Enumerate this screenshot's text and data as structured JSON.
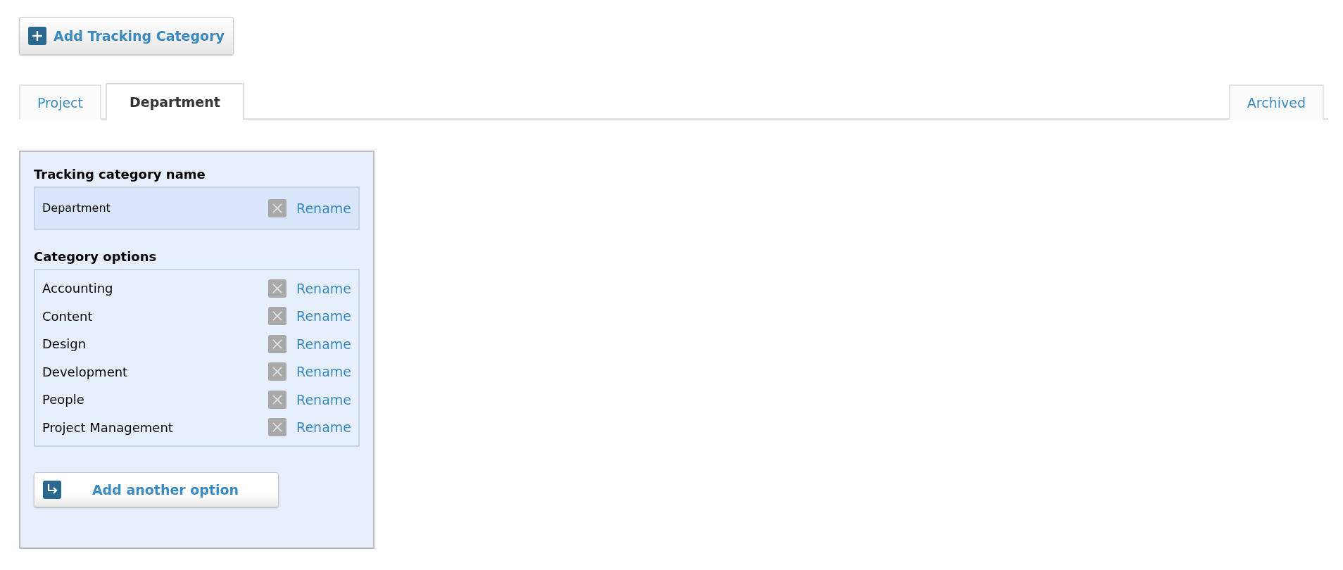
{
  "add_button": {
    "label": "Add Tracking Category"
  },
  "tabs": [
    {
      "label": "Project",
      "selected": false
    },
    {
      "label": "Department",
      "selected": true
    }
  ],
  "archived_tab": {
    "label": "Archived",
    "selected": false
  },
  "panel": {
    "name_heading": "Tracking category name",
    "name_row": {
      "label": "Department",
      "action": "Rename"
    },
    "options_heading": "Category options",
    "options": [
      {
        "label": "Accounting",
        "action": "Rename"
      },
      {
        "label": "Content",
        "action": "Rename"
      },
      {
        "label": "Design",
        "action": "Rename"
      },
      {
        "label": "Development",
        "action": "Rename"
      },
      {
        "label": "People",
        "action": "Rename"
      },
      {
        "label": "Project Management",
        "action": "Rename"
      }
    ],
    "add_option_button": {
      "label": "Add another option"
    }
  }
}
